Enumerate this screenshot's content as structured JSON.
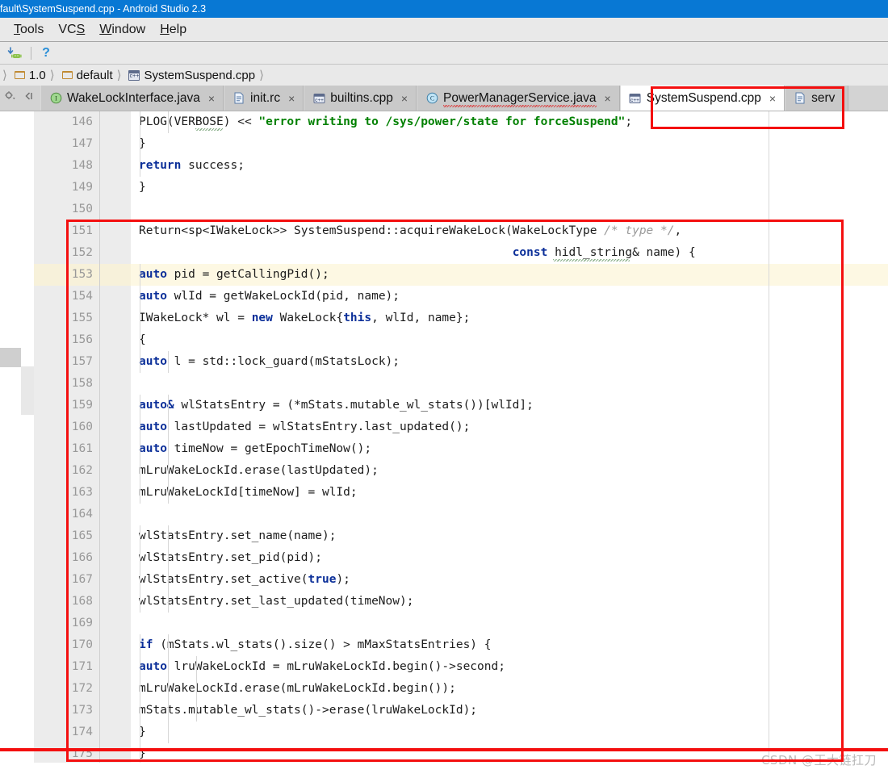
{
  "window": {
    "title": "fault\\SystemSuspend.cpp - Android Studio 2.3",
    "accent_color": "#0878d4"
  },
  "menubar": {
    "items": [
      {
        "label": "Tools",
        "mnemonic": "T"
      },
      {
        "label": "VCS",
        "mnemonic": "S"
      },
      {
        "label": "Window",
        "mnemonic": "W"
      },
      {
        "label": "Help",
        "mnemonic": "H"
      }
    ]
  },
  "toolbar": {
    "buttons": [
      {
        "name": "android-sdk-manager-icon",
        "label": ""
      },
      {
        "name": "help-icon",
        "label": "?"
      }
    ]
  },
  "breadcrumb": {
    "items": [
      {
        "label": "1.0",
        "icon": "folder-icon"
      },
      {
        "label": "default",
        "icon": "folder-icon"
      },
      {
        "label": "SystemSuspend.cpp",
        "icon": "cpp-file-icon"
      }
    ],
    "separator": "〉"
  },
  "tabs": {
    "items": [
      {
        "label": "WakeLockInterface.java",
        "icon": "java-interface-icon",
        "active": false,
        "close": "×",
        "error": false
      },
      {
        "label": "init.rc",
        "icon": "text-file-icon",
        "active": false,
        "close": "×",
        "error": false
      },
      {
        "label": "builtins.cpp",
        "icon": "cpp-file-icon",
        "active": false,
        "close": "×",
        "error": false
      },
      {
        "label": "PowerManagerService.java",
        "icon": "java-class-icon",
        "active": false,
        "close": "×",
        "error": true
      },
      {
        "label": "SystemSuspend.cpp",
        "icon": "cpp-file-icon",
        "active": true,
        "close": "×",
        "error": false
      },
      {
        "label": "serv",
        "icon": "text-file-icon",
        "active": false,
        "close": "",
        "error": false
      }
    ],
    "left_controls": [
      "settings-chevron-icon",
      "collapse-icon"
    ]
  },
  "editor": {
    "first_line_number": 146,
    "highlighted_line": 153,
    "lines": [
      {
        "n": 146,
        "indent": 8,
        "tokens": [
          {
            "t": "PLOG(VERBOSE) ",
            "c": ""
          },
          {
            "t": "<< ",
            "c": ""
          },
          {
            "t": "\"error writing to /sys/power/state for forceSuspend\"",
            "c": "str"
          },
          {
            "t": ";",
            "c": ""
          }
        ],
        "raw": "        PLOG(VERBOSE) << \"error writing to /sys/power/state for forceSuspend\";"
      },
      {
        "n": 147,
        "indent": 4,
        "tokens": [
          {
            "t": "}",
            "c": ""
          }
        ],
        "raw": "    }"
      },
      {
        "n": 148,
        "indent": 4,
        "tokens": [
          {
            "t": "return",
            "c": "kw"
          },
          {
            "t": " success;",
            "c": ""
          }
        ],
        "raw": "    return success;"
      },
      {
        "n": 149,
        "indent": 0,
        "tokens": [
          {
            "t": "}",
            "c": ""
          }
        ],
        "raw": "}"
      },
      {
        "n": 150,
        "indent": 0,
        "tokens": [],
        "raw": ""
      },
      {
        "n": 151,
        "indent": 0,
        "tokens": [
          {
            "t": "Return<sp<IWakeLock>> SystemSuspend::acquireWakeLock(WakeLockType ",
            "c": ""
          },
          {
            "t": "/* type */",
            "c": "cmt"
          },
          {
            "t": ",",
            "c": ""
          }
        ],
        "raw": "Return<sp<IWakeLock>> SystemSuspend::acquireWakeLock(WakeLockType /* type */,"
      },
      {
        "n": 152,
        "indent": 0,
        "tokens": [
          {
            "t": "                                                     ",
            "c": ""
          },
          {
            "t": "const",
            "c": "kw"
          },
          {
            "t": " hidl_string& name) {",
            "c": ""
          }
        ],
        "raw": "                                                     const hidl_string& name) {"
      },
      {
        "n": 153,
        "indent": 4,
        "tokens": [
          {
            "t": "auto",
            "c": "kw"
          },
          {
            "t": " pid = getCallingPid();",
            "c": ""
          }
        ],
        "raw": "    auto pid = getCallingPid();"
      },
      {
        "n": 154,
        "indent": 4,
        "tokens": [
          {
            "t": "auto",
            "c": "kw"
          },
          {
            "t": " wlId = getWakeLockId(pid, name);",
            "c": ""
          }
        ],
        "raw": "    auto wlId = getWakeLockId(pid, name);"
      },
      {
        "n": 155,
        "indent": 4,
        "tokens": [
          {
            "t": "IWakeLock* wl = ",
            "c": ""
          },
          {
            "t": "new",
            "c": "kw"
          },
          {
            "t": " WakeLock{",
            "c": ""
          },
          {
            "t": "this",
            "c": "kw"
          },
          {
            "t": ", wlId, name};",
            "c": ""
          }
        ],
        "raw": "    IWakeLock* wl = new WakeLock{this, wlId, name};"
      },
      {
        "n": 156,
        "indent": 4,
        "tokens": [
          {
            "t": "{",
            "c": ""
          }
        ],
        "raw": "    {"
      },
      {
        "n": 157,
        "indent": 8,
        "tokens": [
          {
            "t": "auto",
            "c": "kw"
          },
          {
            "t": " l = std::lock_guard(mStatsLock);",
            "c": ""
          }
        ],
        "raw": "        auto l = std::lock_guard(mStatsLock);"
      },
      {
        "n": 158,
        "indent": 0,
        "tokens": [],
        "raw": ""
      },
      {
        "n": 159,
        "indent": 8,
        "tokens": [
          {
            "t": "auto&",
            "c": "kw"
          },
          {
            "t": " wlStatsEntry = (*mStats.mutable_wl_stats())[wlId];",
            "c": ""
          }
        ],
        "raw": "        auto& wlStatsEntry = (*mStats.mutable_wl_stats())[wlId];"
      },
      {
        "n": 160,
        "indent": 8,
        "tokens": [
          {
            "t": "auto",
            "c": "kw"
          },
          {
            "t": " lastUpdated = wlStatsEntry.last_updated();",
            "c": ""
          }
        ],
        "raw": "        auto lastUpdated = wlStatsEntry.last_updated();"
      },
      {
        "n": 161,
        "indent": 8,
        "tokens": [
          {
            "t": "auto",
            "c": "kw"
          },
          {
            "t": " timeNow = getEpochTimeNow();",
            "c": ""
          }
        ],
        "raw": "        auto timeNow = getEpochTimeNow();"
      },
      {
        "n": 162,
        "indent": 8,
        "tokens": [
          {
            "t": "mLruWakeLockId.erase(lastUpdated);",
            "c": ""
          }
        ],
        "raw": "        mLruWakeLockId.erase(lastUpdated);"
      },
      {
        "n": 163,
        "indent": 8,
        "tokens": [
          {
            "t": "mLruWakeLockId[timeNow] = wlId;",
            "c": ""
          }
        ],
        "raw": "        mLruWakeLockId[timeNow] = wlId;"
      },
      {
        "n": 164,
        "indent": 0,
        "tokens": [],
        "raw": ""
      },
      {
        "n": 165,
        "indent": 8,
        "tokens": [
          {
            "t": "wlStatsEntry.set_name(name);",
            "c": ""
          }
        ],
        "raw": "        wlStatsEntry.set_name(name);"
      },
      {
        "n": 166,
        "indent": 8,
        "tokens": [
          {
            "t": "wlStatsEntry.set_pid(pid);",
            "c": ""
          }
        ],
        "raw": "        wlStatsEntry.set_pid(pid);"
      },
      {
        "n": 167,
        "indent": 8,
        "tokens": [
          {
            "t": "wlStatsEntry.set_active(",
            "c": ""
          },
          {
            "t": "true",
            "c": "kw"
          },
          {
            "t": ");",
            "c": ""
          }
        ],
        "raw": "        wlStatsEntry.set_active(true);"
      },
      {
        "n": 168,
        "indent": 8,
        "tokens": [
          {
            "t": "wlStatsEntry.set_last_updated(timeNow);",
            "c": ""
          }
        ],
        "raw": "        wlStatsEntry.set_last_updated(timeNow);"
      },
      {
        "n": 169,
        "indent": 0,
        "tokens": [],
        "raw": ""
      },
      {
        "n": 170,
        "indent": 8,
        "tokens": [
          {
            "t": "if",
            "c": "kw"
          },
          {
            "t": " (mStats.wl_stats().size() > mMaxStatsEntries) {",
            "c": ""
          }
        ],
        "raw": "        if (mStats.wl_stats().size() > mMaxStatsEntries) {"
      },
      {
        "n": 171,
        "indent": 12,
        "tokens": [
          {
            "t": "auto",
            "c": "kw"
          },
          {
            "t": " lruWakeLockId = mLruWakeLockId.begin()->second;",
            "c": ""
          }
        ],
        "raw": "            auto lruWakeLockId = mLruWakeLockId.begin()->second;"
      },
      {
        "n": 172,
        "indent": 12,
        "tokens": [
          {
            "t": "mLruWakeLockId.erase(mLruWakeLockId.begin());",
            "c": ""
          }
        ],
        "raw": "            mLruWakeLockId.erase(mLruWakeLockId.begin());"
      },
      {
        "n": 173,
        "indent": 12,
        "tokens": [
          {
            "t": "mStats.mutable_wl_stats()->erase(lruWakeLockId);",
            "c": ""
          }
        ],
        "raw": "            mStats.mutable_wl_stats()->erase(lruWakeLockId);"
      },
      {
        "n": 174,
        "indent": 8,
        "tokens": [
          {
            "t": "}",
            "c": ""
          }
        ],
        "raw": "        }"
      },
      {
        "n": 175,
        "indent": 4,
        "tokens": [
          {
            "t": "}",
            "c": ""
          }
        ],
        "raw": "    }"
      }
    ]
  },
  "annotations": {
    "tab_highlight_label": "SystemSuspend.cpp",
    "code_block_first_line": 150,
    "code_block_last_line": 174,
    "color": "#f40f0f"
  },
  "watermark": {
    "text": "CSDN @王大链扛刀"
  }
}
